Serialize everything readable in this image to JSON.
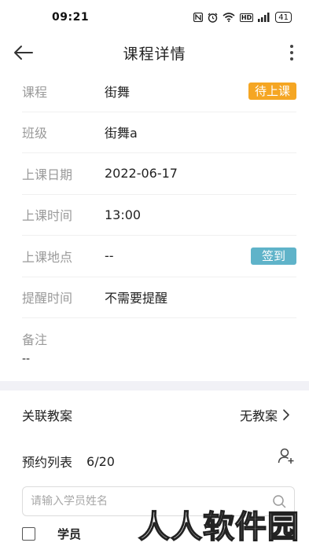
{
  "status_bar": {
    "time": "09:21",
    "icons": [
      "nfc-icon",
      "alarm-icon",
      "wifi-icon",
      "hd-icon",
      "signal-icon"
    ],
    "hd_text": "HD",
    "signal_text": "5G",
    "battery": "41"
  },
  "header": {
    "title": "课程详情"
  },
  "details": [
    {
      "label": "课程",
      "value": "街舞",
      "badge": "待上课",
      "badge_color": "#f5a623"
    },
    {
      "label": "班级",
      "value": "街舞a"
    },
    {
      "label": "上课日期",
      "value": "2022-06-17"
    },
    {
      "label": "上课时间",
      "value": "13:00"
    },
    {
      "label": "上课地点",
      "value": "--",
      "badge": "签到",
      "badge_color": "#5fb3c9"
    },
    {
      "label": "提醒时间",
      "value": "不需要提醒"
    }
  ],
  "remark": {
    "label": "备注",
    "value": "--"
  },
  "linked_plan": {
    "label": "关联教案",
    "value": "无教案"
  },
  "booking": {
    "label": "预约列表",
    "count": "6/20",
    "search_placeholder": "请输入学员姓名"
  },
  "list": {
    "student_header": "学员"
  },
  "watermark": "人人软件园"
}
